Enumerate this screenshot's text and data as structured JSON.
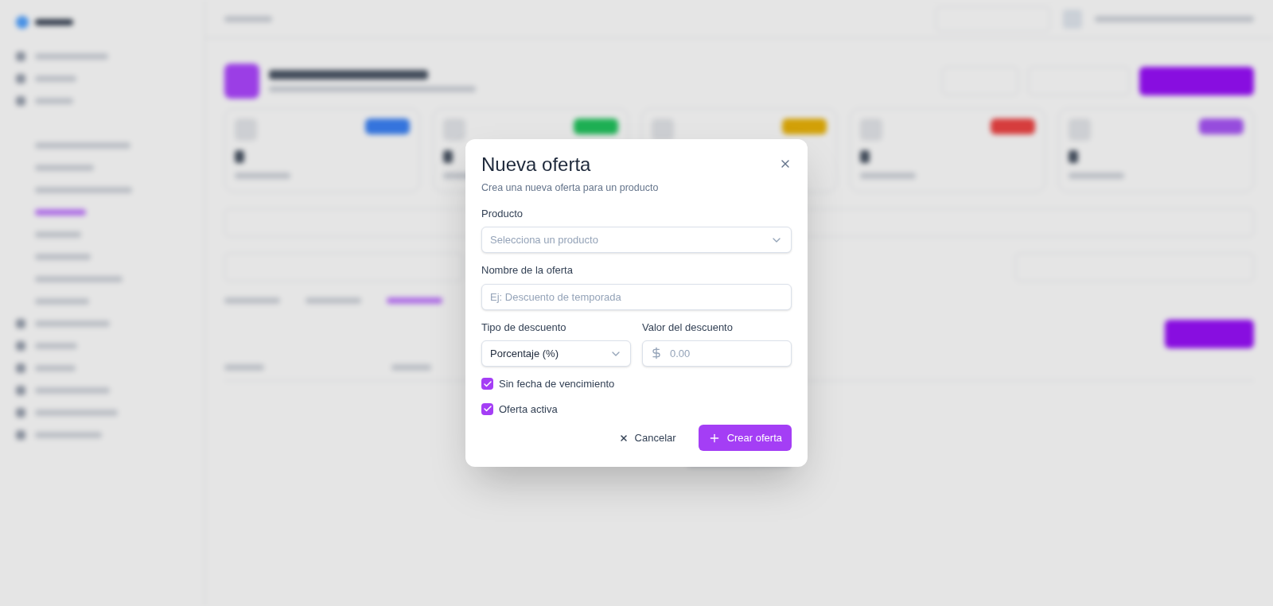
{
  "dialog": {
    "title": "Nueva oferta",
    "subtitle": "Crea una nueva oferta para un producto",
    "product": {
      "label": "Producto",
      "placeholder": "Selecciona un producto"
    },
    "name": {
      "label": "Nombre de la oferta",
      "placeholder": "Ej: Descuento de temporada"
    },
    "discount_type": {
      "label": "Tipo de descuento",
      "value": "Porcentaje (%)"
    },
    "discount_value": {
      "label": "Valor del descuento",
      "placeholder": "0.00"
    },
    "checks": [
      {
        "label": "Sin fecha de vencimiento",
        "checked": true
      },
      {
        "label": "Oferta activa",
        "checked": true
      }
    ],
    "cancel": "Cancelar",
    "submit": "Crear oferta"
  }
}
